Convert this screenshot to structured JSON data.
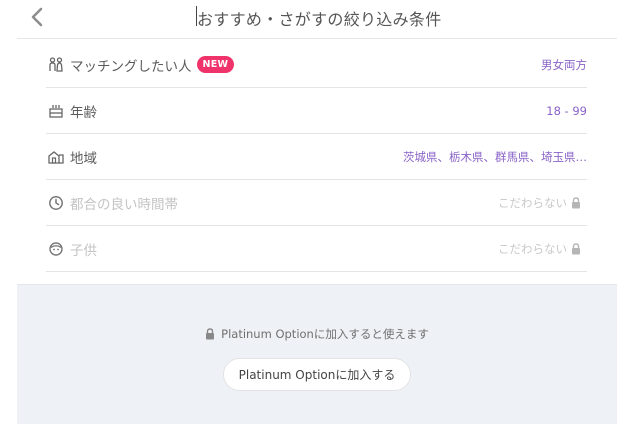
{
  "header": {
    "back_icon": "chevron-left-icon",
    "title": "おすすめ・さがすの絞り込み条件"
  },
  "filters": [
    {
      "icon": "couple-icon",
      "label": "マッチングしたい人",
      "badge": "NEW",
      "value": "男女両方",
      "locked": false
    },
    {
      "icon": "cake-icon",
      "label": "年齢",
      "value": "18 - 99",
      "locked": false
    },
    {
      "icon": "house-icon",
      "label": "地域",
      "value": "茨城県、栃木県、群馬県、埼玉県…",
      "locked": false
    },
    {
      "icon": "clock-icon",
      "label": "都合の良い時間帯",
      "value": "こだわらない",
      "locked": true
    },
    {
      "icon": "child-face-icon",
      "label": "子供",
      "value": "こだわらない",
      "locked": true
    }
  ],
  "footer": {
    "notice": "Platinum Optionに加入すると使えます",
    "button_label": "Platinum Optionに加入する"
  },
  "colors": {
    "accent_value": "#8a63c8",
    "badge": "#f0336b",
    "footer_bg": "#eef1f5"
  }
}
